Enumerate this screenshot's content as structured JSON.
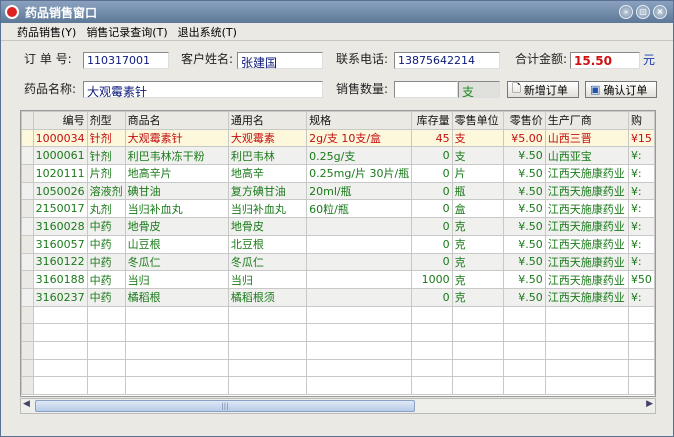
{
  "window": {
    "title": "药品销售窗口"
  },
  "menu": [
    "药品销售(Y)",
    "销售记录查询(T)",
    "退出系统(T)"
  ],
  "form": {
    "order_no_label": "订 单 号:",
    "order_no": "110317001",
    "customer_label": "客户姓名:",
    "customer": "张建国",
    "phone_label": "联系电话:",
    "phone": "13875642214",
    "total_label": "合计金额:",
    "total": "15.50",
    "currency": "元",
    "drug_label": "药品名称:",
    "drug": "大观霉素针",
    "qty_label": "销售数量:",
    "qty": "",
    "unit": "支",
    "new_order": "新增订单",
    "confirm_order": "确认订单"
  },
  "table": {
    "columns": [
      "编号",
      "剂型",
      "商品名",
      "通用名",
      "规格",
      "库存量",
      "零售单位",
      "零售价",
      "生产厂商",
      "购"
    ],
    "rows": [
      [
        "1000034",
        "针剂",
        "大观霉素针",
        "大观霉素",
        "2g/支  10支/盒",
        "45",
        "支",
        "¥5.00",
        "山西三晋",
        "¥15"
      ],
      [
        "1000061",
        "针剂",
        "利巴韦林冻干粉",
        "利巴韦林",
        "0.25g/支",
        "0",
        "支",
        "¥.50",
        "山西亚宝",
        "¥:"
      ],
      [
        "1020111",
        "片剂",
        "地高辛片",
        "地高辛",
        "0.25mg/片 30片/瓶",
        "0",
        "片",
        "¥.50",
        "江西天施康药业",
        "¥:"
      ],
      [
        "1050026",
        "溶液剂",
        "碘甘油",
        "复方碘甘油",
        "20ml/瓶",
        "0",
        "瓶",
        "¥.50",
        "江西天施康药业",
        "¥:"
      ],
      [
        "2150017",
        "丸剂",
        "当归补血丸",
        "当归补血丸",
        " 60粒/瓶",
        "0",
        "盒",
        "¥.50",
        "江西天施康药业",
        "¥:"
      ],
      [
        "3160028",
        "中药",
        "地骨皮",
        "地骨皮",
        "",
        "0",
        "克",
        "¥.50",
        "江西天施康药业",
        "¥:"
      ],
      [
        "3160057",
        "中药",
        "山豆根",
        "北豆根",
        "",
        "0",
        "克",
        "¥.50",
        "江西天施康药业",
        "¥:"
      ],
      [
        "3160122",
        "中药",
        "冬瓜仁",
        "冬瓜仁",
        "",
        "0",
        "克",
        "¥.50",
        "江西天施康药业",
        "¥:"
      ],
      [
        "3160188",
        "中药",
        "当归",
        "当归",
        "",
        "1000",
        "克",
        "¥.50",
        "江西天施康药业",
        "¥50"
      ],
      [
        "3160237",
        "中药",
        "橘稻根",
        "橘稻根须",
        "",
        "0",
        "克",
        "¥.50",
        "江西天施康药业",
        "¥:"
      ]
    ]
  }
}
